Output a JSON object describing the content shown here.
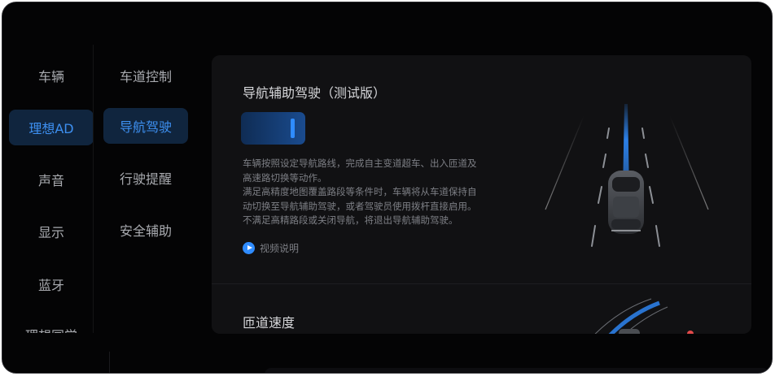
{
  "primary_nav": {
    "items": [
      {
        "label": "车辆"
      },
      {
        "label": "理想AD",
        "active": true
      },
      {
        "label": "声音"
      },
      {
        "label": "显示"
      },
      {
        "label": "蓝牙"
      },
      {
        "label": "理想同学"
      }
    ]
  },
  "secondary_nav": {
    "items": [
      {
        "label": "车道控制"
      },
      {
        "label": "导航驾驶",
        "active": true
      },
      {
        "label": "行驶提醒"
      },
      {
        "label": "安全辅助"
      }
    ]
  },
  "nav_assist": {
    "title": "导航辅助驾驶（测试版）",
    "toggle_on": true,
    "description_lines": [
      "车辆按照设定导航路线，完成自主变道超车、出入匝道及",
      "高速路切换等动作。",
      "满足高精度地图覆盖路段等条件时，车辆将从车道保持自",
      "动切换至导航辅助驾驶，或者驾驶员使用拨杆直接启用。",
      "不满足高精路段或关闭导航，将退出导航辅助驾驶。"
    ],
    "video_link": "视频说明"
  },
  "ramp_speed": {
    "title": "匝道速度"
  },
  "colors": {
    "accent": "#2f8cff",
    "active_bg": "#10253e",
    "panel_bg": "#111113"
  }
}
